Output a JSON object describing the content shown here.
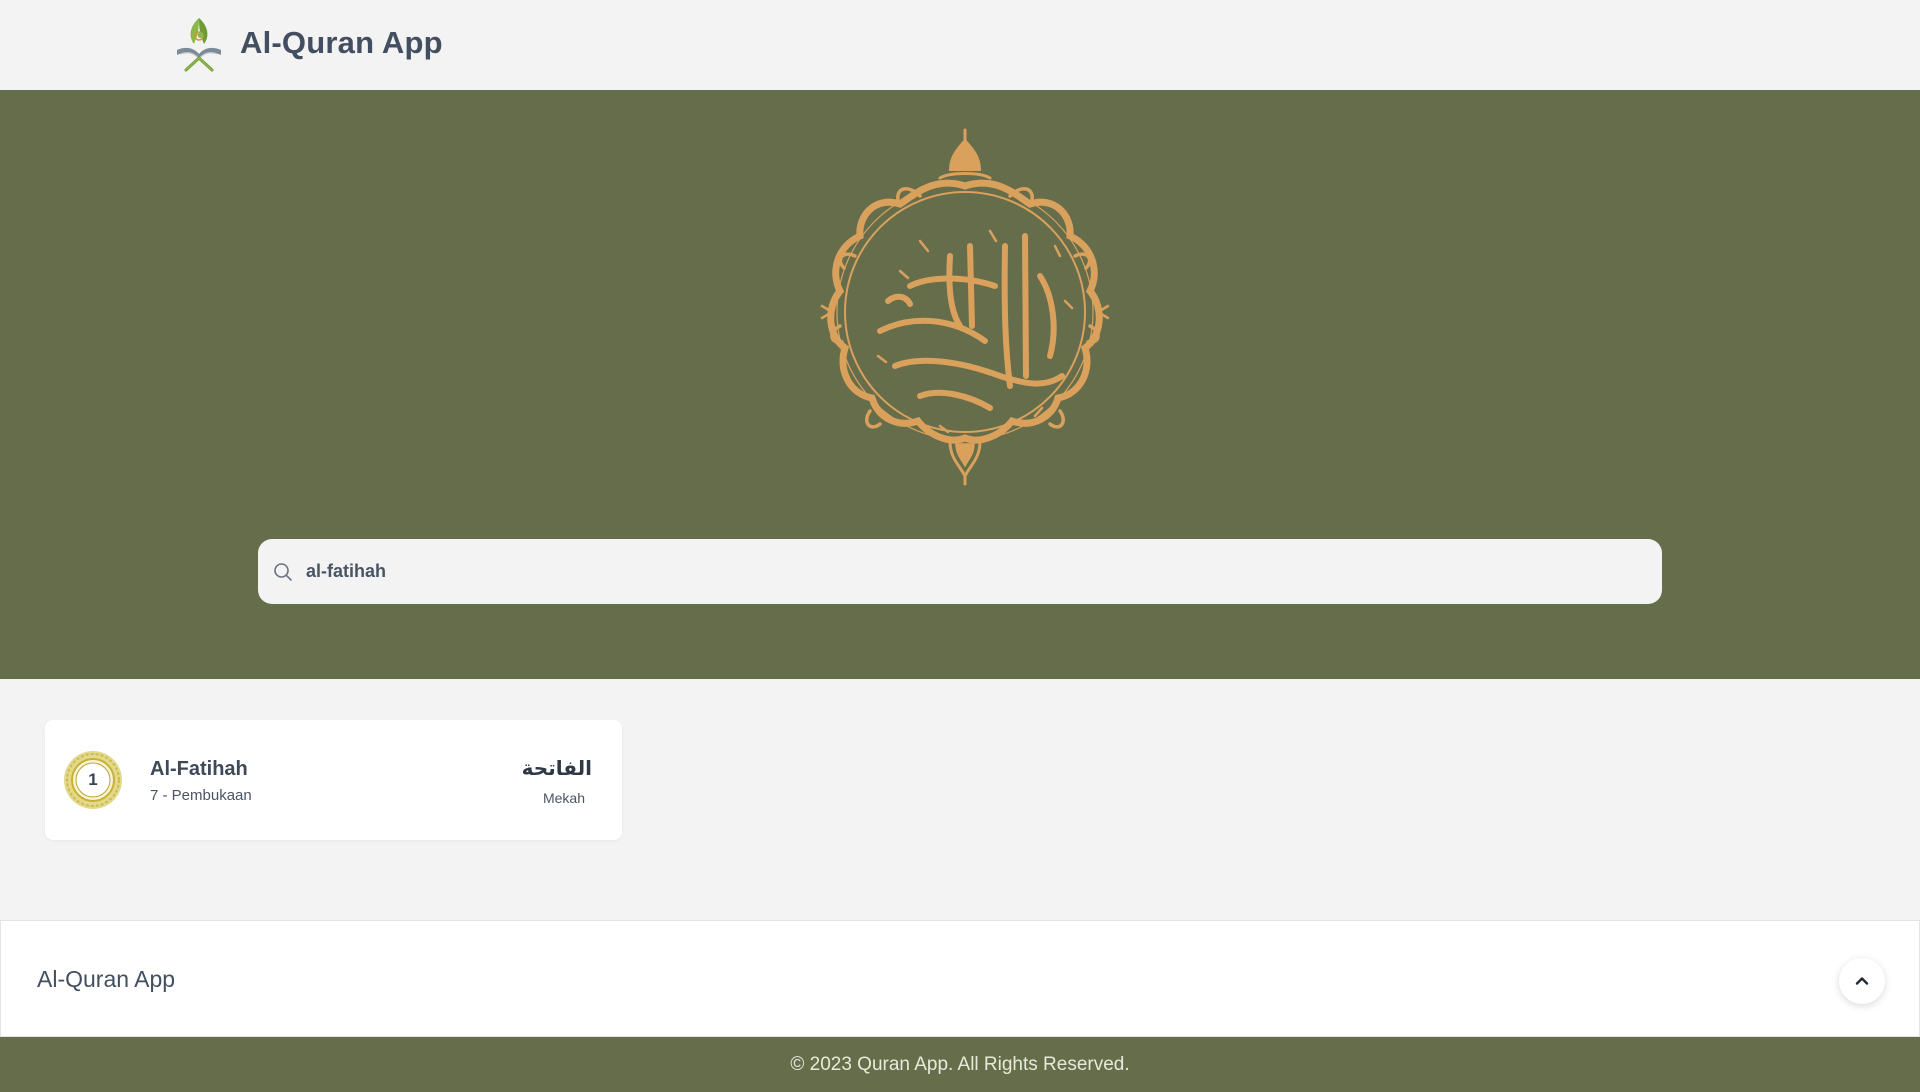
{
  "navbar": {
    "brand_title": "Al-Quran App",
    "logo_icon": "quran-book-logo-icon"
  },
  "hero": {
    "emblem_icon": "al-quran-al-karim-calligraphy-emblem",
    "search": {
      "value": "al-fatihah",
      "icon": "search-icon"
    }
  },
  "results": [
    {
      "number": "1",
      "name": "Al-Fatihah",
      "meta": "7 - Pembukaan",
      "arabic": "الفاتحة",
      "place": "Mekah"
    }
  ],
  "footer": {
    "brand": "Al-Quran App",
    "scroll_top_icon": "chevron-up-icon",
    "copyright": "© 2023 Quran App. All Rights Reserved."
  },
  "colors": {
    "hero_bg": "#666d4b",
    "page_bg": "#f3f3f3",
    "emblem_gold": "#d9a15c",
    "badge_gold": "#d4c35a"
  }
}
